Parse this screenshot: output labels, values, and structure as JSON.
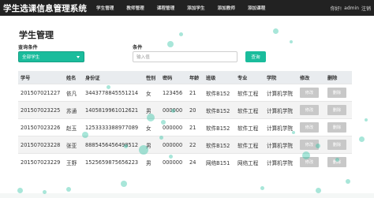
{
  "navbar": {
    "brand": "学生选课信息管理系统",
    "links": [
      "学生管理",
      "教师管理",
      "课程管理",
      "添加学生",
      "添加教师",
      "添加课程"
    ],
    "greeting": "你好!",
    "username": "admin",
    "logout": "注销"
  },
  "main": {
    "title": "学生管理",
    "filter_label": "查询条件",
    "filter_selected": "全部学生",
    "condition_label": "条件",
    "search_placeholder": "输入值",
    "search_button": "查询"
  },
  "table": {
    "headers": [
      "学号",
      "姓名",
      "身份证",
      "性别",
      "密码",
      "年龄",
      "班级",
      "专业",
      "学院",
      "修改",
      "删除"
    ],
    "rows": [
      {
        "id": "201507021227",
        "name": "依凡",
        "idcard": "3443778845551214",
        "gender": "女",
        "password": "123456",
        "age": "21",
        "class": "软件B152",
        "major": "软件工程",
        "college": "计算机学院",
        "edit": "修改",
        "delete": "删除"
      },
      {
        "id": "201507023225",
        "name": "苏通",
        "idcard": "1405819961012621",
        "gender": "男",
        "password": "000000",
        "age": "20",
        "class": "软件B152",
        "major": "软件工程",
        "college": "计算机学院",
        "edit": "修改",
        "delete": "删除"
      },
      {
        "id": "201507023226",
        "name": "赵玉",
        "idcard": "1253333388977089",
        "gender": "女",
        "password": "000000",
        "age": "21",
        "class": "软件B152",
        "major": "软件工程",
        "college": "计算机学院",
        "edit": "修改",
        "delete": "删除"
      },
      {
        "id": "201507023228",
        "name": "张亚",
        "idcard": "8885456456498512",
        "gender": "男",
        "password": "000000",
        "age": "22",
        "class": "软件B152",
        "major": "软件工程",
        "college": "计算机学院",
        "edit": "修改",
        "delete": "删除"
      },
      {
        "id": "201507023229",
        "name": "王野",
        "idcard": "1525659875656223",
        "gender": "男",
        "password": "000000",
        "age": "24",
        "class": "网络B151",
        "major": "网络工程",
        "college": "计算机学院",
        "edit": "修改",
        "delete": "删除"
      }
    ]
  },
  "colors": {
    "navbar_bg": "#222222",
    "accent": "#1abc9c",
    "table_header_bg": "#e9ecef",
    "button_gray": "#c8c8c8"
  }
}
